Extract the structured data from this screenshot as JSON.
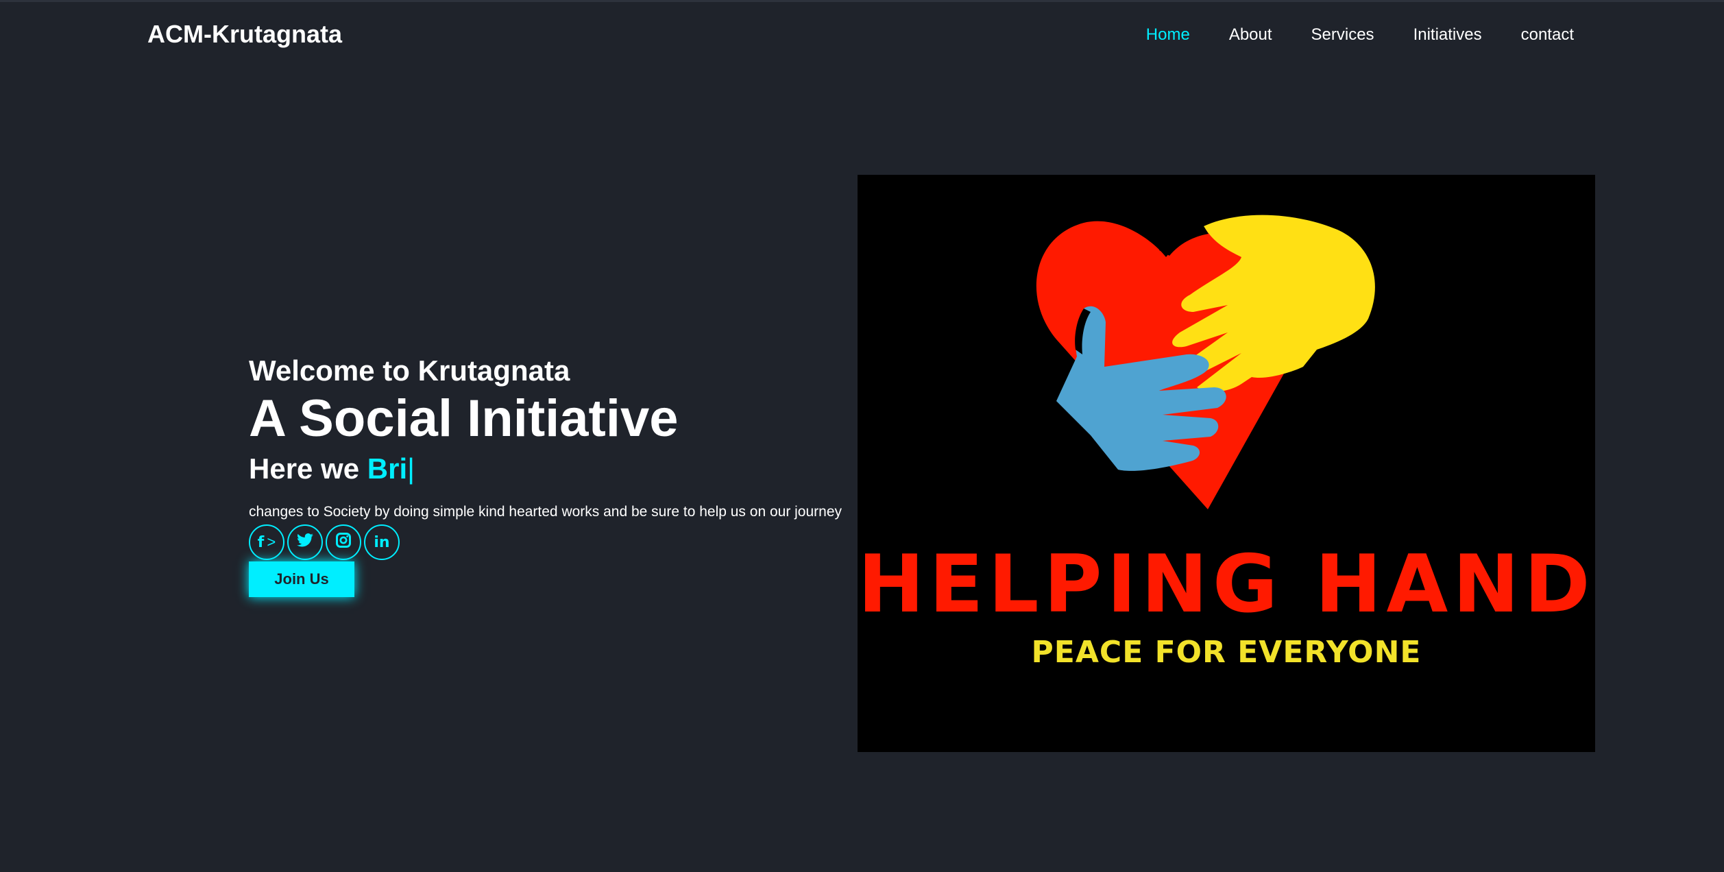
{
  "header": {
    "logo": "ACM-Krutagnata",
    "nav": [
      {
        "label": "Home",
        "active": true
      },
      {
        "label": "About",
        "active": false
      },
      {
        "label": "Services",
        "active": false
      },
      {
        "label": "Initiatives",
        "active": false
      },
      {
        "label": "contact",
        "active": false
      }
    ]
  },
  "hero": {
    "welcome": "Welcome to Krutagnata",
    "headline": "A Social Initiative",
    "tagline_prefix": "Here we ",
    "tagline_typed": "Bri",
    "tagline_cursor": "|",
    "description": "changes to Society by doing simple kind hearted works and be sure to help us on our journey",
    "socials": [
      {
        "icon": "facebook-icon",
        "glyph": "f",
        "extra": ">"
      },
      {
        "icon": "twitter-icon",
        "glyph": "twitter"
      },
      {
        "icon": "instagram-icon",
        "glyph": "instagram"
      },
      {
        "icon": "linkedin-icon",
        "glyph": "in"
      }
    ],
    "join_label": "Join Us"
  },
  "image": {
    "title": "HELPING HAND",
    "subtitle": "PEACE FOR EVERYONE"
  },
  "colors": {
    "background": "#1f232b",
    "accent": "#00eeff",
    "heart_red": "#ff1a00",
    "hand_yellow": "#ffe014",
    "hand_blue": "#4fa3d1",
    "subtitle_yellow": "#f2e22a"
  }
}
